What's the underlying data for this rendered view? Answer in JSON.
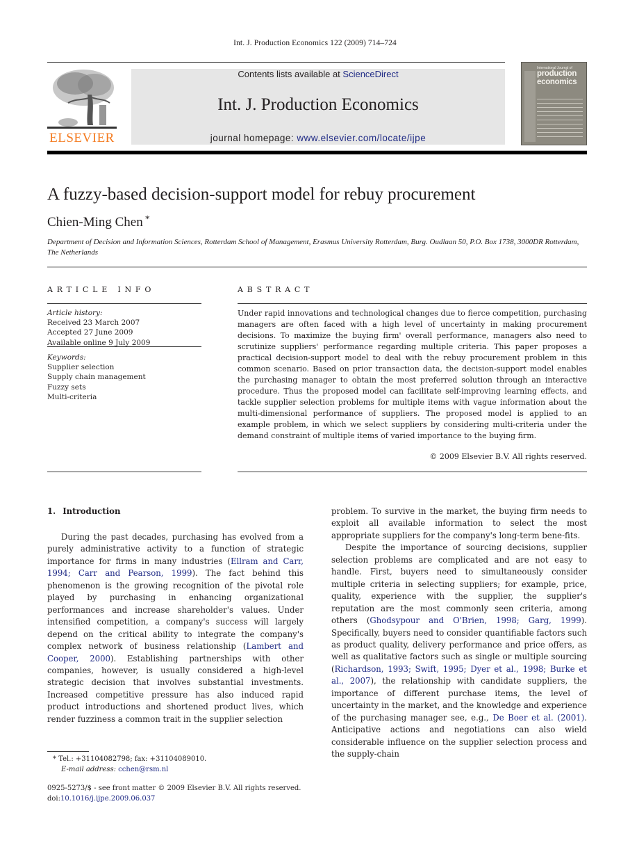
{
  "running_head": "Int. J. Production Economics 122 (2009) 714–724",
  "header": {
    "publisher_logo_text": "ELSEVIER",
    "contents_prefix": "Contents lists available at ",
    "contents_link": "ScienceDirect",
    "journal_title": "Int. J. Production Economics",
    "homepage_prefix": "journal homepage: ",
    "homepage_link": "www.elsevier.com/locate/ijpe",
    "cover": {
      "small_text": "International Journal of",
      "title_line1": "production",
      "title_line2": "economics"
    },
    "colors": {
      "elsevier_orange": "#f47b20",
      "link_blue": "#1f2a85",
      "banner_grey": "#e6e6e6"
    }
  },
  "article": {
    "title": "A fuzzy-based decision-support model for rebuy procurement",
    "author": "Chien-Ming Chen",
    "author_mark": "*",
    "affiliation": "Department of Decision and Information Sciences, Rotterdam School of Management, Erasmus University Rotterdam, Burg. Oudlaan 50, P.O. Box 1738, 3000DR Rotterdam, The Netherlands"
  },
  "article_info": {
    "heading": "ARTICLE INFO",
    "history_label": "Article history:",
    "history": [
      "Received 23 March 2007",
      "Accepted 27 June 2009",
      "Available online 9 July 2009"
    ],
    "keywords_label": "Keywords:",
    "keywords": [
      "Supplier selection",
      "Supply chain management",
      "Fuzzy sets",
      "Multi-criteria"
    ]
  },
  "abstract": {
    "heading": "ABSTRACT",
    "text": "Under rapid innovations and technological changes due to fierce competition, purchasing managers are often faced with a high level of uncertainty in making procurement decisions. To maximize the buying firm' overall performance, managers also need to scrutinize suppliers' performance regarding multiple criteria. This paper proposes a practical decision-support model to deal with the rebuy procurement problem in this common scenario. Based on prior transaction data, the decision-support model enables the purchasing manager to obtain the most preferred solution through an interactive procedure. Thus the proposed model can facilitate self-improving learning effects, and tackle supplier selection problems for multiple items with vague information about the multi-dimensional performance of suppliers. The proposed model is applied to an example problem, in which we select suppliers by considering multi-criteria under the demand constraint of multiple items of varied importance to the buying firm.",
    "copyright": "© 2009 Elsevier B.V. All rights reserved."
  },
  "body": {
    "section_number": "1.",
    "section_title": "Introduction",
    "col1": {
      "p1_a": "During the past decades, purchasing has evolved from a purely administrative activity to a function of strategic importance for firms in many industries (",
      "p1_cite1": "Ellram and Carr, 1994; Carr and Pearson, 1999",
      "p1_b": "). The fact behind this phenomenon is the growing recognition of the pivotal role played by purchasing in enhancing organizational performances and increase shareholder's values. Under intensified competition, a company's success will largely depend on the critical ability to integrate the company's complex network of business relationship (",
      "p1_cite2": "Lambert and Cooper, 2000",
      "p1_c": "). Establishing partnerships with other companies, however, is usually considered a high-level strategic decision that involves substantial investments. Increased competitive pressure has also induced rapid product introductions and shortened product lives, which render fuzziness a common trait in the supplier selection"
    },
    "col2": {
      "p1": "problem. To survive in the market, the buying firm needs to exploit all available information to select the most appropriate suppliers for the company's long-term bene-fits.",
      "p2_a": "Despite the importance of sourcing decisions, supplier selection problems are complicated and are not easy to handle. First, buyers need to simultaneously consider multiple criteria in selecting suppliers; for example, price, quality, experience with the supplier, the supplier's reputation are the most commonly seen criteria, among others (",
      "p2_cite1": "Ghodsypour and O'Brien, 1998; Garg, 1999",
      "p2_b": "). Specifically, buyers need to consider quantifiable factors such as product quality, delivery performance and price offers, as well as qualitative factors such as single or multiple sourcing (",
      "p2_cite2": "Richardson, 1993; Swift, 1995; Dyer et al., 1998; Burke et al., 2007",
      "p2_c": "), the relationship with candidate suppliers, the importance of different purchase items, the level of uncertainty in the market, and the knowledge and experience of the purchasing manager see, e.g., ",
      "p2_cite3": "De Boer et al. (2001)",
      "p2_d": ". Anticipative actions and negotiations can also wield considerable influence on the supplier selection process and the supply-chain"
    }
  },
  "footnote": {
    "mark": "*",
    "contact": "Tel.: +31104082798; fax: +31104089010.",
    "email_label": "E-mail address: ",
    "email": "cchen@rsm.nl"
  },
  "front_matter": {
    "issn_line": "0925-5273/$ - see front matter © 2009 Elsevier B.V. All rights reserved.",
    "doi_prefix": "doi:",
    "doi": "10.1016/j.ijpe.2009.06.037"
  }
}
